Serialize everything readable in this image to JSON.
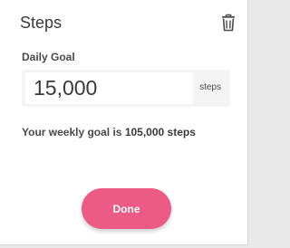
{
  "dialog": {
    "title": "Steps",
    "delete_icon": "trash-icon",
    "goal_label": "Daily Goal",
    "goal_value": "15,000",
    "goal_unit": "steps",
    "weekly_prefix": "Your weekly goal is",
    "weekly_value": "105,000 steps",
    "done_label": "Done"
  },
  "colors": {
    "accent": "#ec5b86"
  }
}
